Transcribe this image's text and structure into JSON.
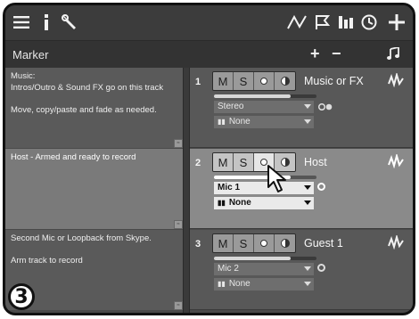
{
  "toolbar": {
    "left_icons": [
      "menu-icon",
      "info-icon",
      "wrench-icon"
    ],
    "right_icons": [
      "automation-icon",
      "flag-icon",
      "mixer-icon",
      "clock-icon",
      "plus-icon"
    ]
  },
  "marker_bar": {
    "title": "Marker",
    "add": "+",
    "remove": "−"
  },
  "tracks": [
    {
      "number": "1",
      "name": "Music or FX",
      "note": "Music:\nIntros/Outro & Sound FX go on this track\n\nMove, copy/paste and fade as needed.",
      "input": "Stereo",
      "output": "None",
      "armed": false,
      "volume": 0.75
    },
    {
      "number": "2",
      "name": "Host",
      "note": "Host - Armed and ready to record",
      "input": "Mic 1",
      "output": "None",
      "armed": true,
      "volume": 0.75
    },
    {
      "number": "3",
      "name": "Guest 1",
      "note": "Second Mic or Loopback from Skype.\n\nArm track to record",
      "input": "Mic 2",
      "output": "None",
      "armed": false,
      "volume": 0.75
    }
  ],
  "buttons": {
    "mute": "M",
    "solo": "S"
  },
  "step_badge": "3",
  "colors": {
    "armed_row": "#8a8a8a",
    "normal_row": "#585858"
  }
}
